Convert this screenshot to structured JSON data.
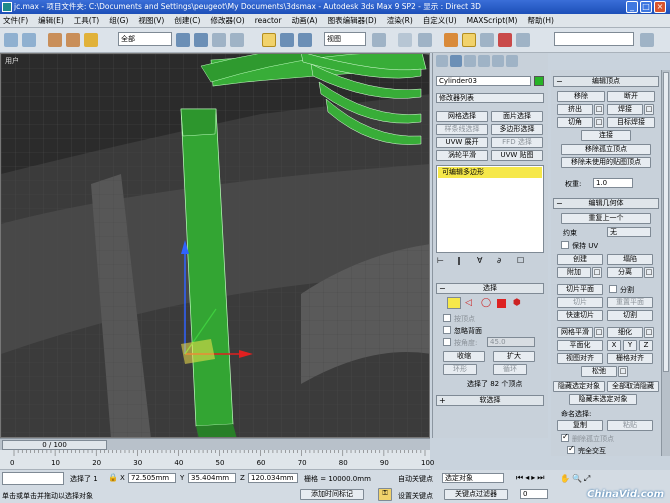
{
  "window": {
    "title": "jc.max - 项目文件夹: C:\\Documents and Settings\\peugeot\\My Documents\\3dsmax - Autodesk 3ds Max 9 SP2 - 显示 : Direct 3D"
  },
  "menu": [
    "文件(F)",
    "编辑(E)",
    "工具(T)",
    "组(G)",
    "视图(V)",
    "创建(C)",
    "修改器(O)",
    "reactor",
    "动画(A)",
    "图表编辑器(D)",
    "渲染(R)",
    "自定义(U)",
    "MAXScript(M)",
    "帮助(H)"
  ],
  "toolbar": {
    "selection_filter": "全部",
    "view_mode": "视图"
  },
  "viewport": {
    "label": "用户"
  },
  "modifier": {
    "object_name": "Cylinder03",
    "object_color": "#27b327",
    "modifier_list": "修改器列表",
    "buttons": [
      "网格选择",
      "面片选择",
      "样条线选择",
      "多边形选择",
      "UVW 展开",
      "FFD 选择",
      "涡轮平滑",
      "UVW 贴图"
    ],
    "stack_item": "可编辑多边形",
    "select_title": "选择",
    "by_vertex": "按顶点",
    "ignore_back": "忽略背面",
    "by_angle": "按角度:",
    "angle_value": "45.0",
    "shrink": "收缩",
    "grow": "扩大",
    "ring": "环形",
    "loop": "循环",
    "selected_count": "选择了 82 个顶点",
    "soft_select": "软选择"
  },
  "edit_vertex": {
    "title": "编辑顶点",
    "remove": "移除",
    "break": "断开",
    "extrude": "挤出",
    "weld": "焊接",
    "chamfer": "切角",
    "target_weld": "目标焊接",
    "connect": "连接",
    "remove_isolated": "移除孤立顶点",
    "remove_unused_map": "移除未使用的贴图顶点",
    "weight_label": "权重:",
    "weight_value": "1.0"
  },
  "edit_geometry": {
    "title": "编辑几何体",
    "repeat_last": "重复上一个",
    "constraint_label": "约束",
    "constraint_value": "无",
    "preserve_uv": "保持 UV",
    "create": "创建",
    "collapse": "塌陷",
    "attach": "附加",
    "detach": "分离",
    "slice_plane": "切片平面",
    "split": "分割",
    "slice": "切片",
    "reset_plane": "重置平面",
    "quickslice": "快速切片",
    "cut": "切割",
    "meshsmooth": "网格平滑",
    "tessellate": "细化",
    "make_planar": "平面化",
    "x": "X",
    "y": "Y",
    "z": "Z",
    "view_align": "视图对齐",
    "grid_align": "栅格对齐",
    "relax": "松弛",
    "hide_selected": "隐藏选定对象",
    "unhide_all": "全部取消隐藏",
    "hide_unselected": "隐藏未选定对象",
    "named_selections": "命名选择:",
    "copy": "复制",
    "paste": "粘贴",
    "delete_isolated": "删除孤立顶点",
    "full_interactivity": "完全交互"
  },
  "timeline": {
    "frame": "0 / 100",
    "ticks": [
      "0",
      "10",
      "20",
      "30",
      "40",
      "50",
      "60",
      "70",
      "80",
      "90",
      "100"
    ]
  },
  "status": {
    "selected": "选择了 1",
    "x_label": "X",
    "x_value": "72.505mm",
    "y_label": "Y",
    "y_value": "35.404mm",
    "z_label": "Z",
    "z_value": "120.034mm",
    "grid": "栅格 = 10000.0mm",
    "auto_key": "自动关键点",
    "selected_object": "选定对象",
    "prompt": "单击或单击并拖动以选择对象",
    "add_time_tag": "添加时间标记",
    "set_key": "设置关键点",
    "key_filter": "关键点过滤器",
    "frame_value": "0",
    "watermark": "ChinaVid.com"
  }
}
